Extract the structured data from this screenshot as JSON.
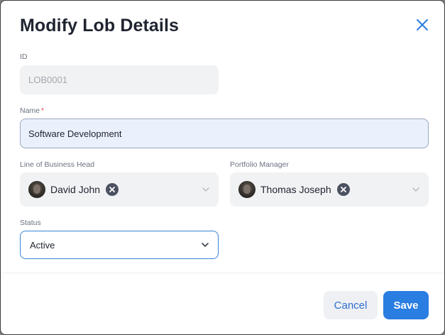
{
  "modal": {
    "title": "Modify Lob Details"
  },
  "form": {
    "id": {
      "label": "ID",
      "value": "LOB0001"
    },
    "name": {
      "label": "Name",
      "required_mark": "*",
      "value": "Software Development"
    },
    "lob_head": {
      "label": "Line of Business Head",
      "person": "David John"
    },
    "portfolio_manager": {
      "label": "Portfolio Manager",
      "person": "Thomas Joseph"
    },
    "status": {
      "label": "Status",
      "value": "Active"
    }
  },
  "footer": {
    "cancel_label": "Cancel",
    "save_label": "Save"
  },
  "colors": {
    "primary": "#2a7de1",
    "required": "#e5484d",
    "field_bg": "#f1f2f4"
  },
  "icons": [
    "close-icon",
    "chevron-down-icon",
    "clear-icon",
    "avatar"
  ]
}
